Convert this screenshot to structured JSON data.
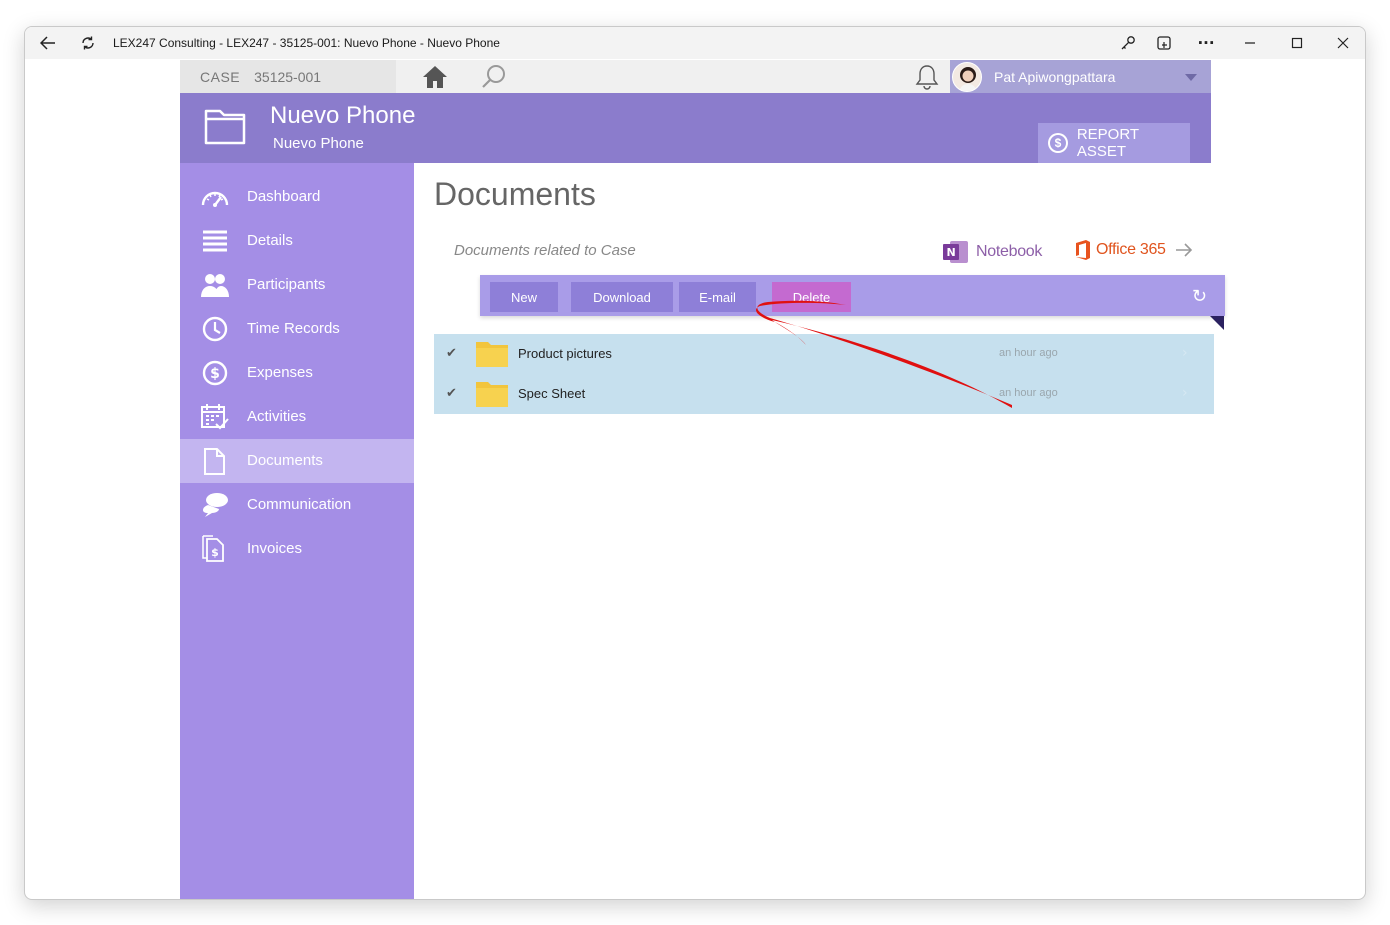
{
  "window": {
    "title": "LEX247 Consulting - LEX247 - 35125-001: Nuevo Phone - Nuevo Phone"
  },
  "topbar": {
    "case_label": "CASE",
    "case_number": "35125-001",
    "user_name": "Pat Apiwongpattara"
  },
  "header": {
    "title": "Nuevo Phone",
    "subtitle": "Nuevo Phone",
    "report_label": "REPORT ASSET"
  },
  "sidebar": {
    "items": [
      {
        "label": "Dashboard",
        "icon": "gauge-icon"
      },
      {
        "label": "Details",
        "icon": "list-icon"
      },
      {
        "label": "Participants",
        "icon": "people-icon"
      },
      {
        "label": "Time Records",
        "icon": "clock-icon"
      },
      {
        "label": "Expenses",
        "icon": "dollar-icon"
      },
      {
        "label": "Activities",
        "icon": "calendar-icon"
      },
      {
        "label": "Documents",
        "icon": "document-icon"
      },
      {
        "label": "Communication",
        "icon": "chat-icon"
      },
      {
        "label": "Invoices",
        "icon": "invoice-icon"
      }
    ],
    "active_index": 6
  },
  "main": {
    "title": "Documents",
    "subtitle": "Documents related to Case",
    "notebook_label": "Notebook",
    "office_label": "Office 365",
    "toolbar": {
      "new_label": "New",
      "download_label": "Download",
      "email_label": "E-mail",
      "delete_label": "Delete"
    },
    "files": [
      {
        "name": "Product pictures",
        "time": "an hour ago"
      },
      {
        "name": "Spec Sheet",
        "time": "an hour ago"
      }
    ]
  },
  "colors": {
    "header": "#8b7ccc",
    "sidebar": "#a48ee6",
    "sidebar_active": "#c3b5f0",
    "toolbar": "#a99ce8",
    "button": "#8e7fd8",
    "delete_button": "#c46ad0",
    "selected_row": "#c6e0ee",
    "annotation_arrow": "#e01010"
  }
}
